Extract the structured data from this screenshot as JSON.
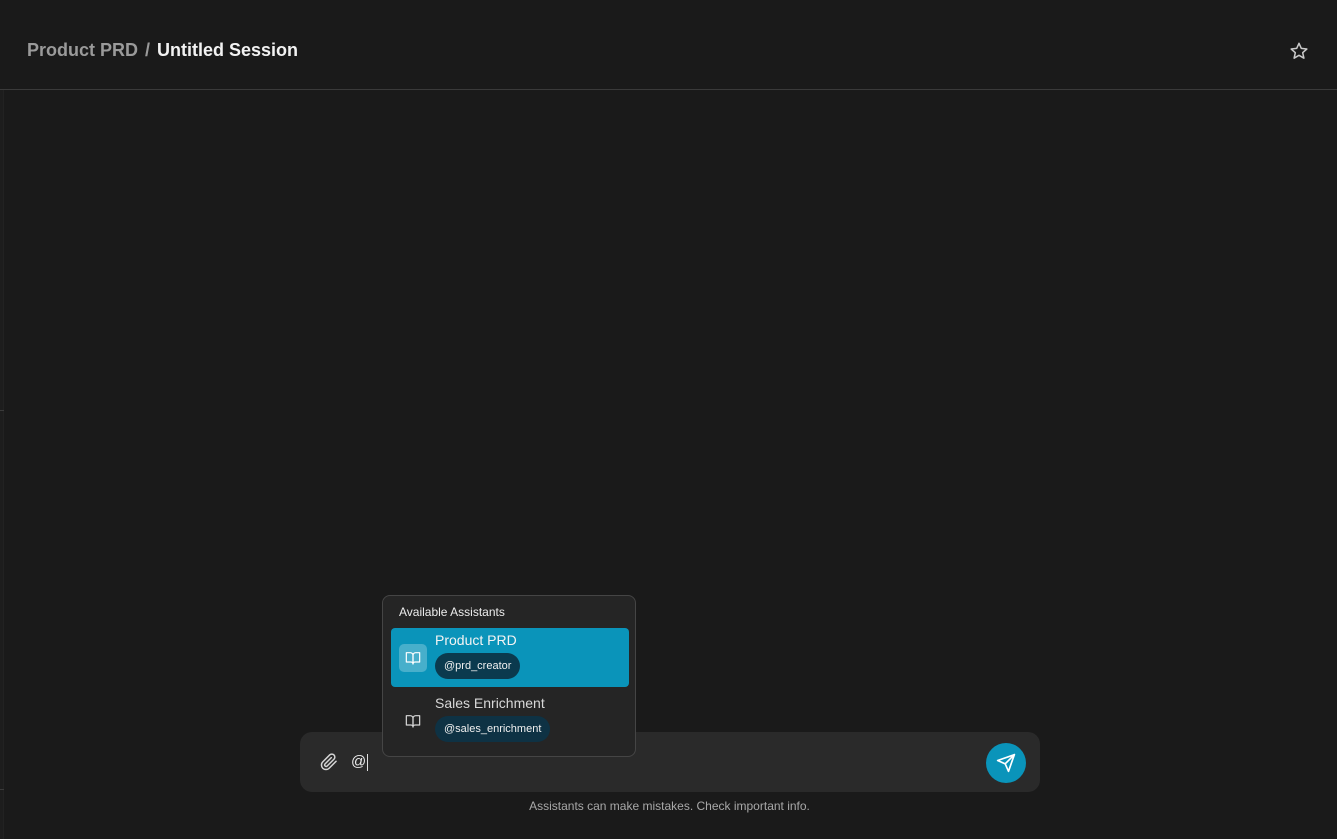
{
  "header": {
    "breadcrumb_parent": "Product PRD",
    "breadcrumb_separator": "/",
    "breadcrumb_current": "Untitled Session",
    "favorite_icon": "star-icon"
  },
  "composer": {
    "attach_icon": "paperclip-icon",
    "input_value": "@",
    "send_icon": "send-icon"
  },
  "mention_popover": {
    "title": "Available Assistants",
    "items": [
      {
        "name": "Product PRD",
        "handle": "@prd_creator",
        "icon": "book-open-icon",
        "selected": true
      },
      {
        "name": "Sales Enrichment",
        "handle": "@sales_enrichment",
        "icon": "book-open-icon",
        "selected": false
      }
    ]
  },
  "footer": {
    "disclaimer": "Assistants can make mistakes. Check important info."
  },
  "colors": {
    "background": "#1a1a1a",
    "accent": "#0a94ba",
    "handle_badge": "#0e3244"
  }
}
